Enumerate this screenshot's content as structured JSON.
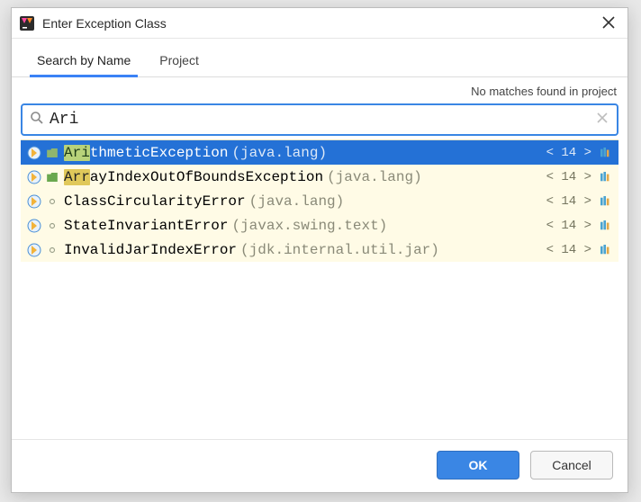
{
  "dialog": {
    "title": "Enter Exception Class"
  },
  "tabs": [
    {
      "label": "Search by Name",
      "active": true
    },
    {
      "label": "Project",
      "active": false
    }
  ],
  "status": {
    "no_matches": "No matches found in project"
  },
  "search": {
    "value": "Ari",
    "placeholder": ""
  },
  "results": [
    {
      "match": "Ari",
      "rest": "thmeticException",
      "pkg": "(java.lang)",
      "badge": "< 14 >",
      "selected": true
    },
    {
      "match": "Arr",
      "rest": "ayIndexOutOfBoundsException",
      "pkg": "(java.lang)",
      "badge": "< 14 >",
      "selected": false
    },
    {
      "match": "",
      "rest": "ClassCircularityError",
      "pkg": "(java.lang)",
      "badge": "< 14 >",
      "selected": false
    },
    {
      "match": "",
      "rest": "StateInvariantError",
      "pkg": "(javax.swing.text)",
      "badge": "< 14 >",
      "selected": false
    },
    {
      "match": "",
      "rest": "InvalidJarIndexError",
      "pkg": "(jdk.internal.util.jar)",
      "badge": "< 14 >",
      "selected": false
    }
  ],
  "buttons": {
    "ok": "OK",
    "cancel": "Cancel"
  },
  "icons": {
    "app": "intellij-icon",
    "exception": "exception-class-icon",
    "folder": "folder-icon",
    "library": "library-icon"
  }
}
